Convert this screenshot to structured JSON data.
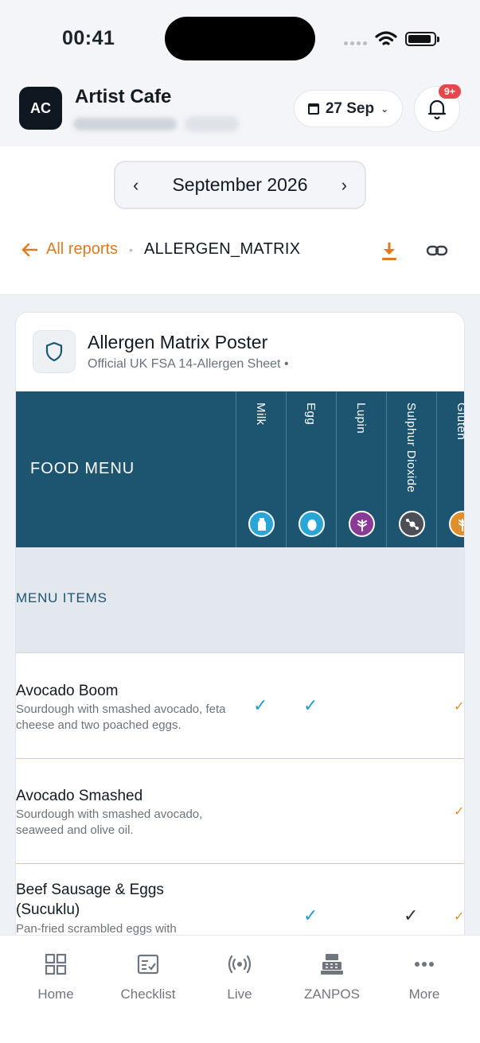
{
  "status_bar": {
    "time": "00:41"
  },
  "header": {
    "avatar_initials": "AC",
    "business_name": "Artist Cafe",
    "date_selector": "27 Sep",
    "notification_badge": "9+"
  },
  "month_nav": {
    "label": "September 2026"
  },
  "breadcrumb": {
    "back_label": "All reports",
    "current": "ALLERGEN_MATRIX"
  },
  "card": {
    "title": "Allergen Matrix Poster",
    "subtitle": "Official UK FSA 14-Allergen Sheet •",
    "food_menu_label": "FOOD MENU",
    "allergens": [
      {
        "name": "Milk",
        "icon": "milk-bottle-icon",
        "color": "#2aa6d6"
      },
      {
        "name": "Egg",
        "icon": "egg-icon",
        "color": "#2aa6d6"
      },
      {
        "name": "Lupin",
        "icon": "lupin-flower-icon",
        "color": "#8a3b96"
      },
      {
        "name": "Sulphur Dioxide",
        "icon": "molecule-icon",
        "color": "#4c4f55"
      },
      {
        "name": "Gluten",
        "icon": "wheat-icon",
        "color": "#e0902a"
      }
    ],
    "section_label": "MENU ITEMS",
    "items": [
      {
        "name": "Avocado Boom",
        "description": "Sourdough with smashed avocado, feta cheese and two poached eggs."
      },
      {
        "name": "Avocado Smashed",
        "description": "Sourdough with smashed avocado, seaweed and olive oil."
      },
      {
        "name": "Beef Sausage & Eggs (Sucuklu)",
        "description": "Pan-fried scrambled eggs with"
      }
    ]
  },
  "bottom_nav": [
    {
      "label": "Home",
      "icon": "grid-icon"
    },
    {
      "label": "Checklist",
      "icon": "checklist-icon"
    },
    {
      "label": "Live",
      "icon": "broadcast-icon"
    },
    {
      "label": "ZANPOS",
      "icon": "cash-register-icon"
    },
    {
      "label": "More",
      "icon": "more-dots-icon"
    }
  ]
}
